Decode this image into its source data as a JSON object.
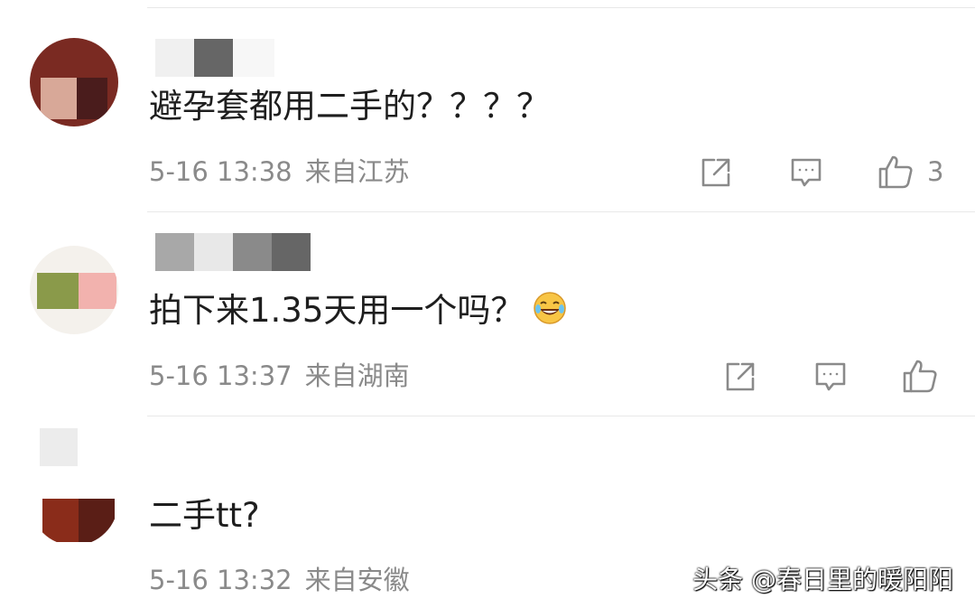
{
  "comments": [
    {
      "text": "避孕套都用二手的？？？？",
      "date": "5-16 13:38",
      "location": "来自江苏",
      "like_count": "3"
    },
    {
      "text": "拍下来1.35天用一个吗？",
      "date": "5-16 13:37",
      "location": "来自湖南",
      "like_count": ""
    },
    {
      "text": "二手tt?",
      "date": "5-16 13:32",
      "location": "来自安徽",
      "like_count": ""
    }
  ],
  "icons": {
    "share": "share-icon",
    "reply": "comment-icon",
    "like": "thumbs-up-icon",
    "emoji": "laughing-tears-emoji"
  },
  "colors": {
    "text": "#1e1e1e",
    "meta": "#8a8a8a",
    "divider": "#e8e8e8"
  },
  "watermark": "头条 @春日里的暖阳阳"
}
